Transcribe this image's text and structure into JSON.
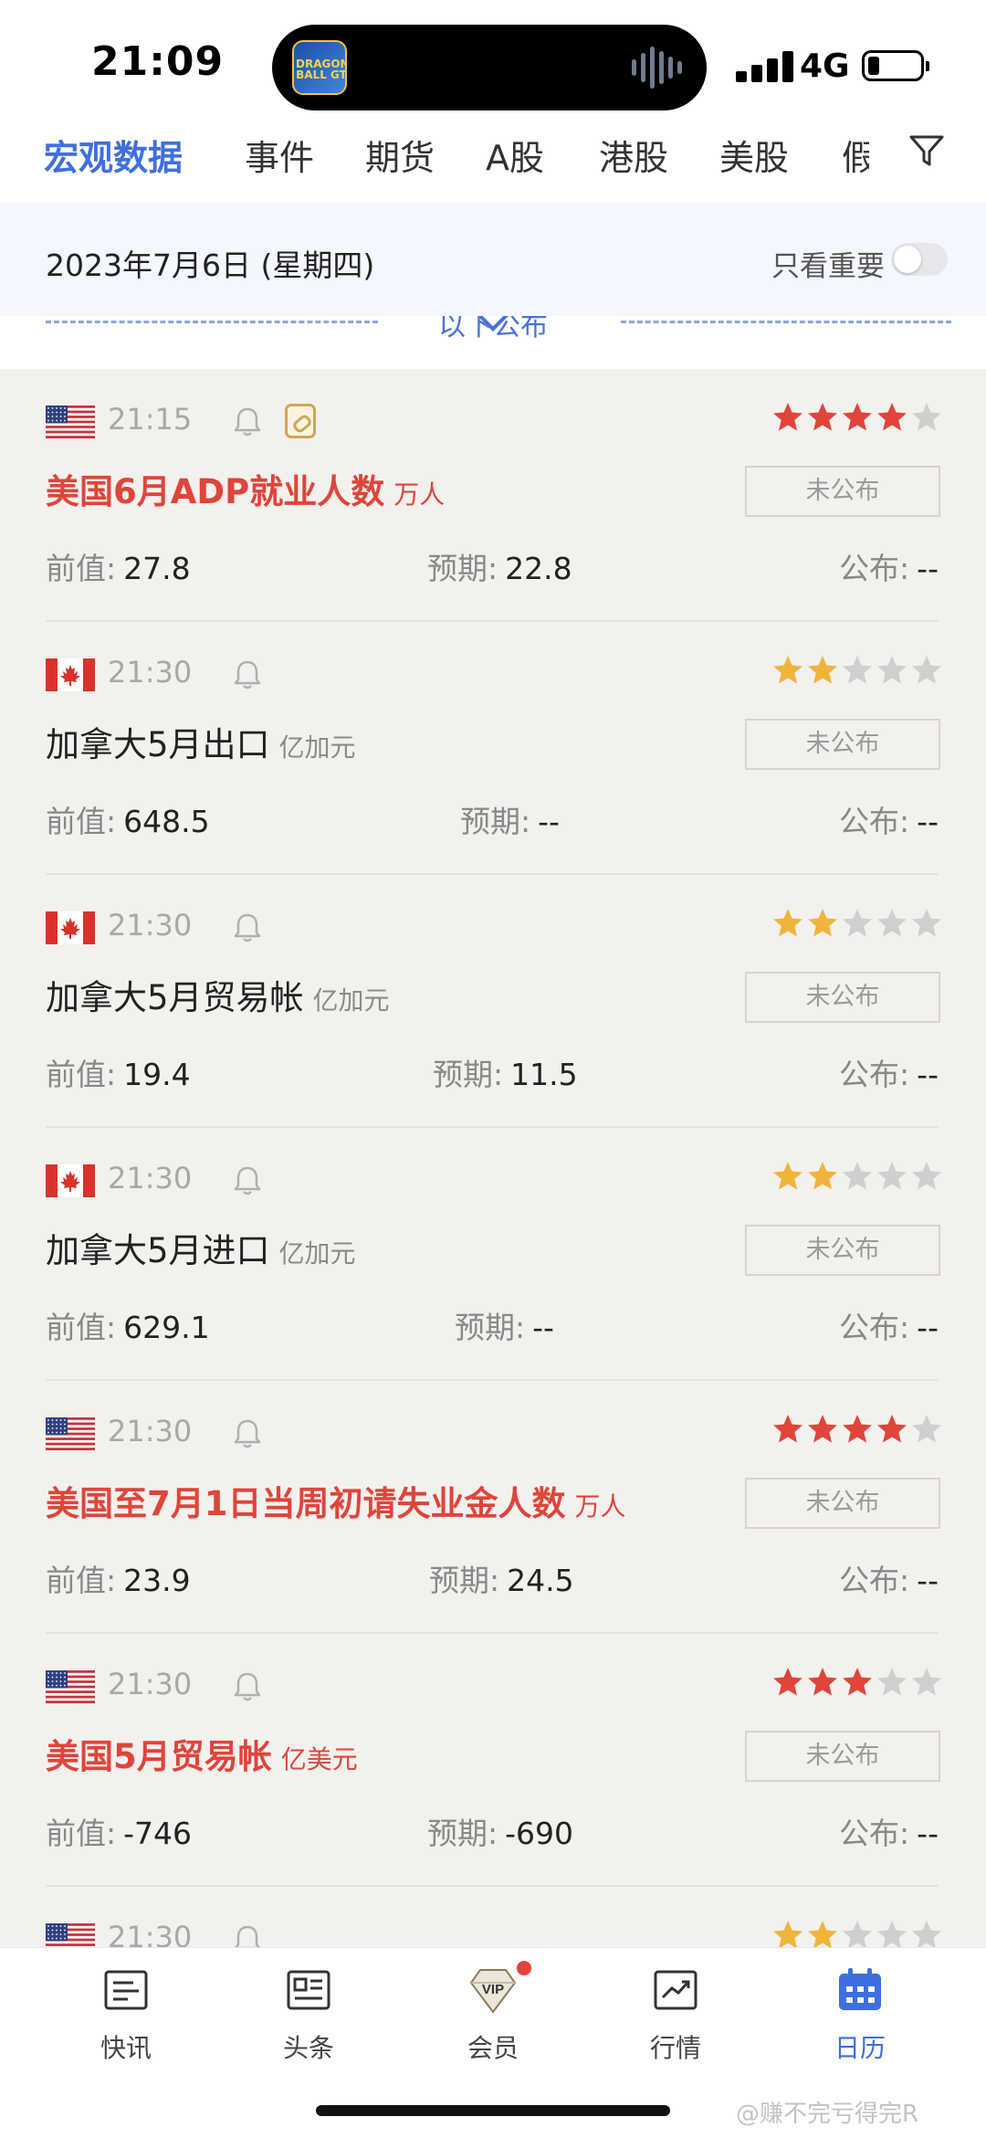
{
  "status_bar": {
    "time": "21:09",
    "network": "4G",
    "island_app_label": "DRAGON BALL GT"
  },
  "tabs": [
    {
      "label": "宏观数据",
      "active": true
    },
    {
      "label": "事件"
    },
    {
      "label": "期货"
    },
    {
      "label": "A股"
    },
    {
      "label": "港股"
    },
    {
      "label": "美股"
    },
    {
      "label": "假"
    }
  ],
  "date_header": {
    "date": "2023年7月6日 (星期四)",
    "filter_label": "只看重要",
    "filter_on": false
  },
  "released_divider": "以下公布",
  "labels": {
    "previous": "前值:",
    "forecast": "预期:",
    "actual": "公布:",
    "pending": "未公布"
  },
  "events": [
    {
      "country": "us",
      "time": "21:15",
      "has_link": true,
      "importance": 4,
      "star_color": "#e0443a",
      "important": true,
      "title": "美国6月ADP就业人数",
      "unit": "万人",
      "previous": "27.8",
      "forecast": "22.8",
      "actual": "--"
    },
    {
      "country": "ca",
      "time": "21:30",
      "has_link": false,
      "importance": 2,
      "star_color": "#f0b43a",
      "important": false,
      "title": "加拿大5月出口",
      "unit": "亿加元",
      "previous": "648.5",
      "forecast": "--",
      "actual": "--"
    },
    {
      "country": "ca",
      "time": "21:30",
      "has_link": false,
      "importance": 2,
      "star_color": "#f0b43a",
      "important": false,
      "title": "加拿大5月贸易帐",
      "unit": "亿加元",
      "previous": "19.4",
      "forecast": "11.5",
      "actual": "--"
    },
    {
      "country": "ca",
      "time": "21:30",
      "has_link": false,
      "importance": 2,
      "star_color": "#f0b43a",
      "important": false,
      "title": "加拿大5月进口",
      "unit": "亿加元",
      "previous": "629.1",
      "forecast": "--",
      "actual": "--"
    },
    {
      "country": "us",
      "time": "21:30",
      "has_link": false,
      "importance": 4,
      "star_color": "#e0443a",
      "important": true,
      "title": "美国至7月1日当周初请失业金人数",
      "unit": "万人",
      "previous": "23.9",
      "forecast": "24.5",
      "actual": "--"
    },
    {
      "country": "us",
      "time": "21:30",
      "has_link": false,
      "importance": 3,
      "star_color": "#e0443a",
      "important": true,
      "title": "美国5月贸易帐",
      "unit": "亿美元",
      "previous": "-746",
      "forecast": "-690",
      "actual": "--"
    },
    {
      "country": "us",
      "time": "21:30",
      "has_link": false,
      "importance": 2,
      "star_color": "#f0b43a",
      "important": false,
      "title": "",
      "unit": "",
      "previous": "",
      "forecast": "",
      "actual": ""
    }
  ],
  "bottom_nav": [
    {
      "label": "快讯",
      "icon": "news-flash-icon"
    },
    {
      "label": "头条",
      "icon": "headline-icon"
    },
    {
      "label": "会员",
      "icon": "vip-diamond-icon",
      "badge": true
    },
    {
      "label": "行情",
      "icon": "market-chart-icon"
    },
    {
      "label": "日历",
      "icon": "calendar-icon",
      "active": true
    }
  ],
  "watermark": "@赚不完亏得完R"
}
